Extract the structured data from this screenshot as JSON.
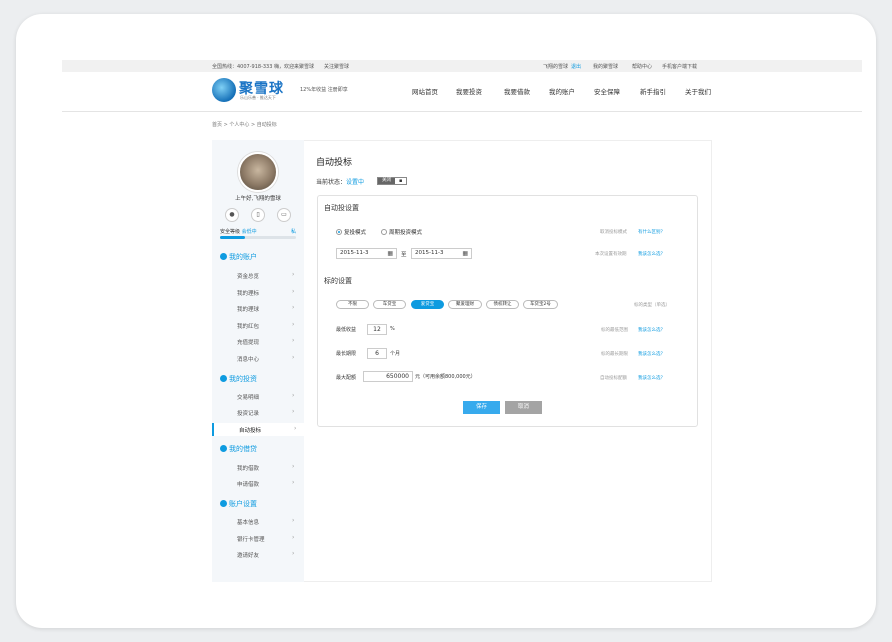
{
  "topbar": {
    "hotline": "全国热线：4007-918-333",
    "welcome": "嗨，欢迎来聚雪球",
    "follow": "关注聚雪球",
    "user": "飞翔的雪球",
    "logout": "退出",
    "myaccount": "我的聚雪球",
    "help": "帮助中心",
    "mobile": "手机客户端下载"
  },
  "header": {
    "logo_text": "聚雪球",
    "logo_sub": "乐山乐善 · 推达天下",
    "slogan": "12%年收益 注册即享",
    "nav": [
      "网站首页",
      "我要投资",
      "我要借款",
      "我的账户",
      "安全保障",
      "新手指引",
      "关于我们"
    ]
  },
  "breadcrumb": "首页 > 个人中心 > 自动投标",
  "sidebar": {
    "greeting": "上午好,飞翔的雪球",
    "security_label": "安全等级",
    "security_level": "会低中",
    "security_upgrade": "私",
    "security_progress": 0.33,
    "sections": [
      {
        "title": "我的账户",
        "items": [
          "资金总览",
          "我的理标",
          "我的理球",
          "我的红包",
          "充值提现",
          "消息中心"
        ]
      },
      {
        "title": "我的投资",
        "items": [
          "交易明细",
          "投资记录",
          "自动投标"
        ]
      },
      {
        "title": "我的借贷",
        "items": [
          "我的借款",
          "申请借款"
        ]
      },
      {
        "title": "账户设置",
        "items": [
          "基本信息",
          "银行卡管理",
          "邀请好友"
        ]
      }
    ]
  },
  "main": {
    "title": "自动投标",
    "status_label": "当前状态：",
    "status_value": "设置中",
    "toggle_label": "关闭",
    "auto_settings_title": "自动投设置",
    "mode_repeat": "复投模式",
    "mode_period": "周期投资模式",
    "mode_hint": "取消投标模式",
    "mode_help": "有什么区别？",
    "date_start": "2015-11-3",
    "date_to": "至",
    "date_end": "2015-11-3",
    "date_hint": "本次设置有效期",
    "date_help": "我该怎么选？",
    "bid_settings_title": "标的设置",
    "types": [
      "不限",
      "车贷宝",
      "爱贷宝",
      "聚爱理财",
      "债权转让",
      "车贷宝2号"
    ],
    "types_hint": "标的类型（单选）",
    "min_yield_label": "最低收益",
    "min_yield_value": "12",
    "min_yield_unit": "%",
    "min_yield_hint": "标的最低范围",
    "min_yield_help": "我该怎么选？",
    "max_term_label": "最长期限",
    "max_term_value": "6",
    "max_term_unit": "个月",
    "max_term_hint": "标的最长期限",
    "max_term_help": "我该怎么选？",
    "max_amount_label": "最大配额",
    "max_amount_value": "650000",
    "max_amount_unit": "元（可用余额800,000元）",
    "max_amount_hint": "自动投标配额",
    "max_amount_help": "我该怎么选？",
    "save_label": "保存",
    "cancel_label": "取消"
  },
  "colors": {
    "accent": "#0e9be0",
    "save": "#37aaed",
    "cancel": "#a4a4a4"
  }
}
